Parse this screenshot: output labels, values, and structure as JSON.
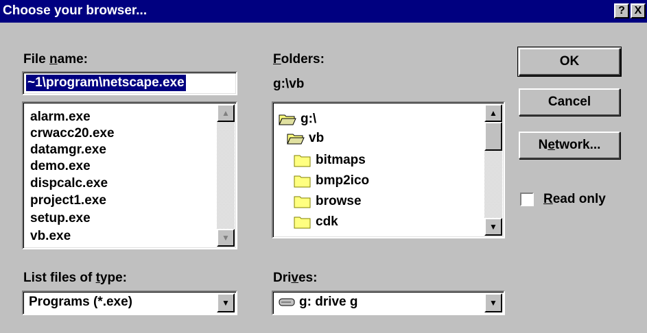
{
  "window": {
    "title": "Choose your browser...",
    "help_label": "?",
    "close_label": "X"
  },
  "file_name": {
    "label_pre": "File ",
    "label_key": "n",
    "label_post": "ame:",
    "value": "~1\\program\\netscape.exe"
  },
  "files": {
    "items": [
      "alarm.exe",
      "crwacc20.exe",
      "datamgr.exe",
      "demo.exe",
      "dispcalc.exe",
      "project1.exe",
      "setup.exe",
      "vb.exe"
    ]
  },
  "folders": {
    "label_key": "F",
    "label_post": "olders:",
    "current_path": "g:\\vb",
    "items": [
      {
        "label": "g:\\",
        "icon": "open-folder-icon"
      },
      {
        "label": "vb",
        "icon": "open-folder-icon"
      },
      {
        "label": "bitmaps",
        "icon": "folder-icon"
      },
      {
        "label": "bmp2ico",
        "icon": "folder-icon"
      },
      {
        "label": "browse",
        "icon": "folder-icon"
      },
      {
        "label": "cdk",
        "icon": "folder-icon"
      }
    ]
  },
  "file_type": {
    "label_pre": "List files of ",
    "label_key": "t",
    "label_post": "ype:",
    "selected": "Programs (*.exe)"
  },
  "drives": {
    "label_pre": "Dri",
    "label_key": "v",
    "label_post": "es:",
    "selected": "g: drive g"
  },
  "buttons": {
    "ok": "OK",
    "cancel": "Cancel",
    "network_pre": "N",
    "network_key": "e",
    "network_post": "twork..."
  },
  "read_only": {
    "label_key": "R",
    "label_post": "ead only",
    "checked": false
  },
  "colors": {
    "titlebar": "#000080",
    "face": "#c0c0c0",
    "selection": "#000080"
  }
}
